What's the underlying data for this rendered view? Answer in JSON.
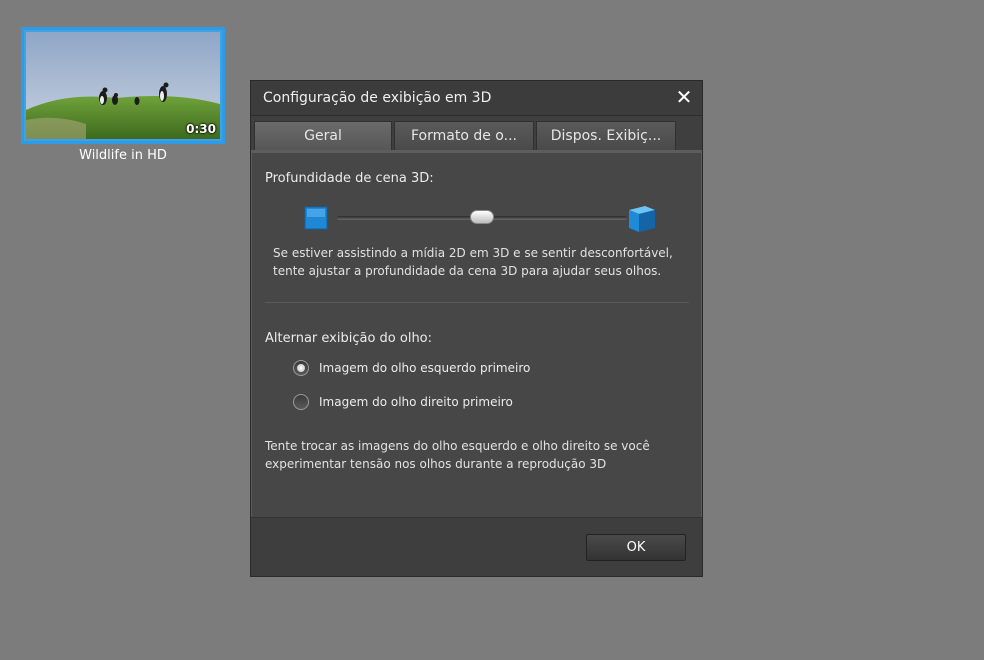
{
  "media": {
    "title": "Wildlife in HD",
    "duration": "0:30"
  },
  "dialog": {
    "title": "Configuração de exibição em 3D",
    "tabs": [
      "Geral",
      "Formato de o...",
      "Dispos. Exibiç..."
    ],
    "active_tab": "Geral",
    "depth_label": "Profundidade de cena 3D:",
    "depth_value": 0.5,
    "depth_help": [
      "Se estiver assistindo a mídia 2D em 3D e se sentir desconfortável,",
      "tente ajustar a profundidade da cena 3D para ajudar seus olhos."
    ],
    "eye_label": "Alternar exibição do olho:",
    "eye_options": [
      "Imagem do olho esquerdo primeiro",
      "Imagem do olho direito primeiro"
    ],
    "eye_selected": 0,
    "eye_help": [
      "Tente trocar as imagens do olho esquerdo e olho direito se você",
      "experimentar tensão nos olhos durante a reprodução 3D"
    ],
    "ok_label": "OK"
  },
  "colors": {
    "accent": "#2d9be6",
    "background": "#7c7c7c",
    "dialog": "#474747"
  }
}
